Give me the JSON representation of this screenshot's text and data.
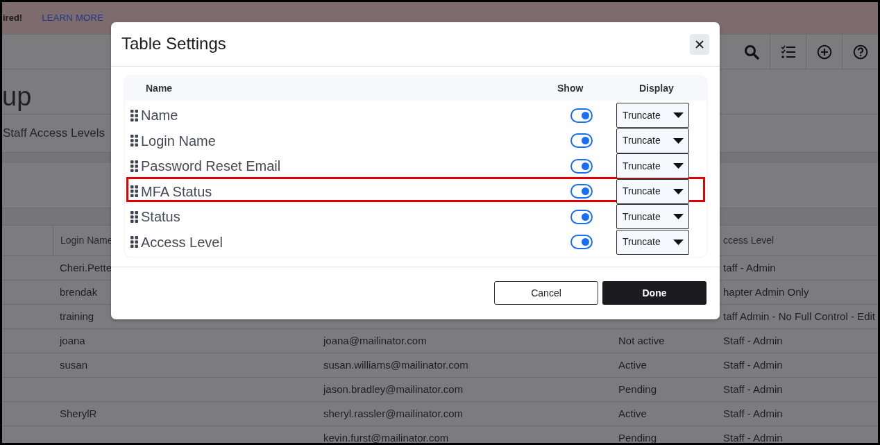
{
  "banner": {
    "message": "ired!",
    "link": "LEARN MORE"
  },
  "toolbar": {
    "buttons": [
      {
        "kind": "search"
      },
      {
        "kind": "checklist"
      },
      {
        "kind": "add"
      },
      {
        "kind": "help"
      }
    ]
  },
  "page": {
    "title": "up",
    "tabs": [
      {
        "label": "Staff Access Levels"
      }
    ]
  },
  "table": {
    "columns": {
      "login": "Login Name",
      "access_level": "ccess Level"
    },
    "rows": [
      {
        "login": "Cheri.Pette",
        "access_level": "taff - Admin"
      },
      {
        "login": "brendak",
        "access_level": "hapter Admin Only"
      },
      {
        "login": "training",
        "access_level": "taff Admin - No Full Control - Edit"
      },
      {
        "login": "joana",
        "email": "joana@mailinator.com",
        "status": "Not active",
        "access_level": "Staff - Admin"
      },
      {
        "login": "susan",
        "email": "susan.williams@mailinator.com",
        "status": "Active",
        "access_level": "Staff - Admin"
      },
      {
        "email": "jason.bradley@mailinator.com",
        "status": "Pending",
        "access_level": "Staff - Admin"
      },
      {
        "login": "SherylR",
        "email": "sheryl.rassler@mailinator.com",
        "status": "Active",
        "access_level": "Staff - Admin"
      },
      {
        "email": "kevin.furst@mailinator.com",
        "status": "Pending",
        "access_level": "Staff - Admin"
      }
    ]
  },
  "modal": {
    "title": "Table Settings",
    "columns": {
      "name": "Name",
      "show": "Show",
      "display": "Display"
    },
    "rows": [
      {
        "label": "Name",
        "shown": true,
        "display": "Truncate",
        "highlighted": false
      },
      {
        "label": "Login Name",
        "shown": true,
        "display": "Truncate",
        "highlighted": false
      },
      {
        "label": "Password Reset Email",
        "shown": true,
        "display": "Truncate",
        "highlighted": false
      },
      {
        "label": "MFA Status",
        "shown": true,
        "display": "Truncate",
        "highlighted": true
      },
      {
        "label": "Status",
        "shown": true,
        "display": "Truncate",
        "highlighted": false
      },
      {
        "label": "Access Level",
        "shown": true,
        "display": "Truncate",
        "highlighted": false
      }
    ],
    "buttons": [
      {
        "label": "Cancel",
        "kind": "secondary"
      },
      {
        "label": "Done",
        "kind": "primary"
      }
    ]
  }
}
